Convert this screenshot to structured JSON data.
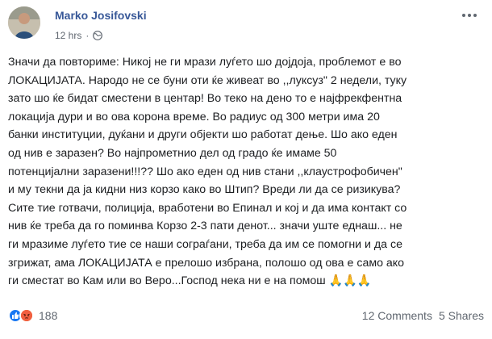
{
  "post": {
    "author": "Marko Josifovski",
    "time": "12 hrs",
    "privacy_icon": "globe-icon",
    "lines": [
      "Значи да повториме: Никој не ги мрази луѓето шо доjдоја, проблемот е во",
      "ЛОКАЦИЈАТА. Народо не се буни оти ќе живеат во ,,луксуз\" 2 недели, туку",
      "зато шо ќе бидат сместени в центар! Во теко на дено то е најфрекфентна",
      "локација дури и во ова корона време. Во радиус од 300 метри има 20",
      "банки институции, дуќани и други објекти шо работат дење. Шо ако еден",
      "од нив е заразен? Во најпрометнио дел од градо ќе имаме 50",
      "потенцијални заразени!!!?? Шо ако еден од нив стани ,,клаустрофобичен\"",
      "и му текни да ја кидни низ корзо како во Штип? Вреди ли да се ризикува?",
      "Сите тие готвачи, полиција, вработени во Епинал и кој и да има контакт со",
      "нив ќе треба да го поминва Корзо 2-3 пати денот... значи уште еднаш... не",
      "ги мразиме луѓето тие се наши сограѓани, треба да им се помогни и да се",
      "згрижат, ама ЛОКАЦИЈАТА е прелошо избрана, полошо од ова е само ако",
      "ги сместат во Кам или во Веро...Господ нека ни е на помош"
    ],
    "emoji": "🙏🙏🙏"
  },
  "footer": {
    "reactions": [
      "like-icon",
      "angry-icon"
    ],
    "reaction_count": "188",
    "comments": "12 Comments",
    "shares": "5 Shares"
  },
  "colors": {
    "author": "#385898",
    "meta": "#606770",
    "like": "#1877f2",
    "angry": "#e9710f"
  }
}
